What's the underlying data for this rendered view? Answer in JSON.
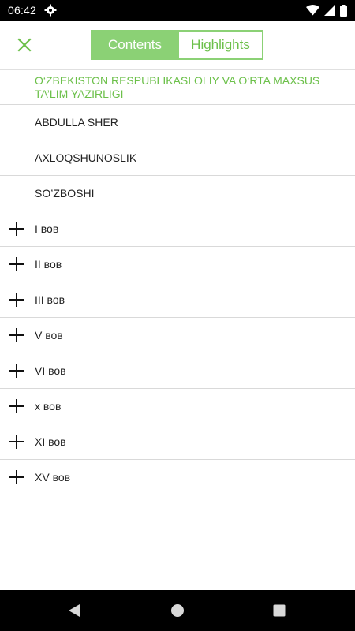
{
  "status_bar": {
    "time": "06:42",
    "icons": [
      "gear-icon",
      "wifi-icon",
      "signal-icon",
      "battery-icon"
    ]
  },
  "toolbar": {
    "close_icon": "close-icon",
    "tabs": [
      {
        "label": "Contents",
        "active": true
      },
      {
        "label": "Highlights",
        "active": false
      }
    ]
  },
  "toc": {
    "items": [
      {
        "label": "O‘ZBEKISTON RESPUBLIKASI OLIY VA O‘RTA MAXSUS TA’LIM YAZIRLIGI",
        "expandable": false,
        "highlighted": true
      },
      {
        "label": "ABDULLA SHER",
        "expandable": false
      },
      {
        "label": "AXLOQSHUNOSLIK",
        "expandable": false
      },
      {
        "label": "SO’ZBOSHI",
        "expandable": false
      },
      {
        "label": "I вов",
        "expandable": true
      },
      {
        "label": "II вов",
        "expandable": true
      },
      {
        "label": "III вов",
        "expandable": true
      },
      {
        "label": "V вов",
        "expandable": true
      },
      {
        "label": "VI вов",
        "expandable": true
      },
      {
        "label": "х вов",
        "expandable": true
      },
      {
        "label": "XI вов",
        "expandable": true
      },
      {
        "label": "XV вов",
        "expandable": true
      }
    ]
  },
  "nav_bar": {
    "icons": [
      "back-icon",
      "home-icon",
      "recents-icon"
    ]
  },
  "colors": {
    "accent": "#8bd175",
    "accent_text": "#6cc04a",
    "status_bar": "#000000"
  }
}
